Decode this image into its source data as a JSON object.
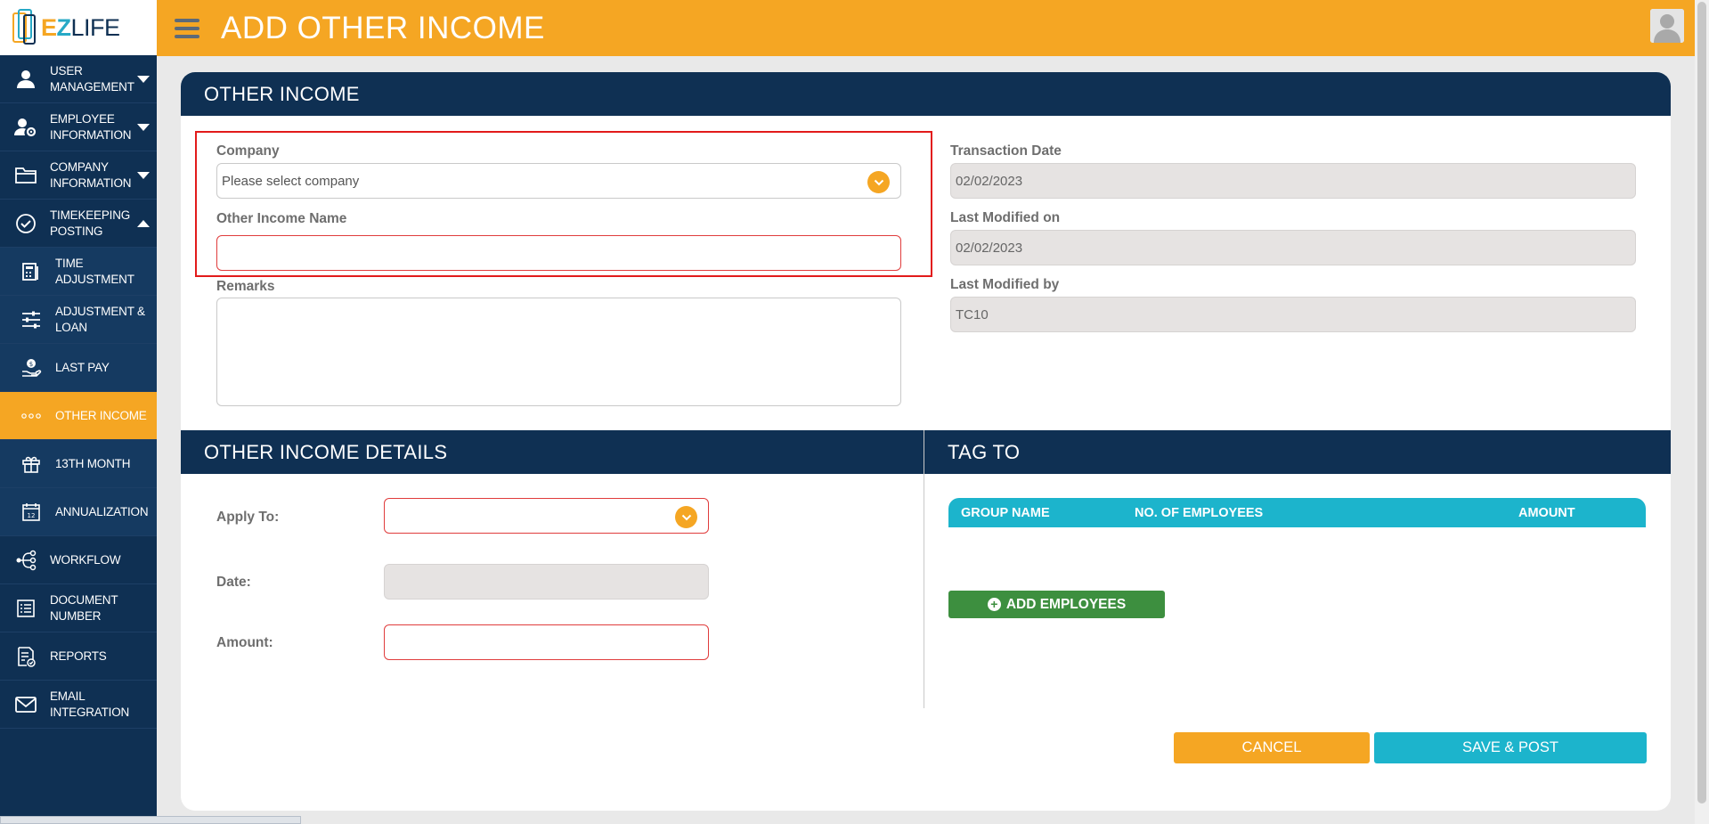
{
  "brand": {
    "e": "E",
    "z": "Z",
    "life": "LIFE"
  },
  "header": {
    "title": "ADD OTHER INCOME"
  },
  "sidebar": {
    "items": [
      {
        "label": "USER MANAGEMENT",
        "icon": "user-icon",
        "caret": "down"
      },
      {
        "label": "EMPLOYEE INFORMATION",
        "icon": "employee-settings-icon",
        "caret": "down"
      },
      {
        "label": "COMPANY INFORMATION",
        "icon": "folder-icon",
        "caret": "down"
      },
      {
        "label": "TIMEKEEPING POSTING",
        "icon": "check-circle-icon",
        "caret": "up"
      },
      {
        "label": "TIME ADJUSTMENT",
        "icon": "calculator-icon"
      },
      {
        "label": "ADJUSTMENT & LOAN",
        "icon": "sliders-icon"
      },
      {
        "label": "LAST PAY",
        "icon": "hand-money-icon"
      },
      {
        "label": "OTHER INCOME",
        "icon": "dots-icon",
        "active": true
      },
      {
        "label": "13TH MONTH",
        "icon": "gift-icon"
      },
      {
        "label": "ANNUALIZATION",
        "icon": "calendar-icon"
      },
      {
        "label": "WORKFLOW",
        "icon": "workflow-icon"
      },
      {
        "label": "DOCUMENT NUMBER",
        "icon": "document-list-icon"
      },
      {
        "label": "REPORTS",
        "icon": "report-icon"
      },
      {
        "label": "EMAIL INTEGRATION",
        "icon": "mail-icon"
      }
    ]
  },
  "form": {
    "section_title": "OTHER INCOME",
    "company_label": "Company",
    "company_placeholder": "Please select company",
    "other_income_name_label": "Other Income Name",
    "other_income_name_value": "",
    "remarks_label": "Remarks",
    "remarks_value": "",
    "transaction_date_label": "Transaction Date",
    "transaction_date_value": "02/02/2023",
    "last_modified_on_label": "Last Modified on",
    "last_modified_on_value": "02/02/2023",
    "last_modified_by_label": "Last Modified by",
    "last_modified_by_value": "TC10"
  },
  "details": {
    "section_title": "OTHER INCOME DETAILS",
    "apply_to_label": "Apply To:",
    "apply_to_value": "",
    "date_label": "Date:",
    "date_value": "",
    "amount_label": "Amount:",
    "amount_value": ""
  },
  "tag_to": {
    "section_title": "TAG TO",
    "columns": [
      "GROUP NAME",
      "NO. OF EMPLOYEES",
      "AMOUNT"
    ],
    "rows": [],
    "add_button_label": "ADD EMPLOYEES"
  },
  "actions": {
    "cancel_label": "CANCEL",
    "save_label": "SAVE & POST"
  },
  "colors": {
    "sidebar": "#0f3053",
    "accent": "#f5a623",
    "teal": "#1cb4cc",
    "green": "#3d8f3f",
    "error": "#e03c3c"
  }
}
